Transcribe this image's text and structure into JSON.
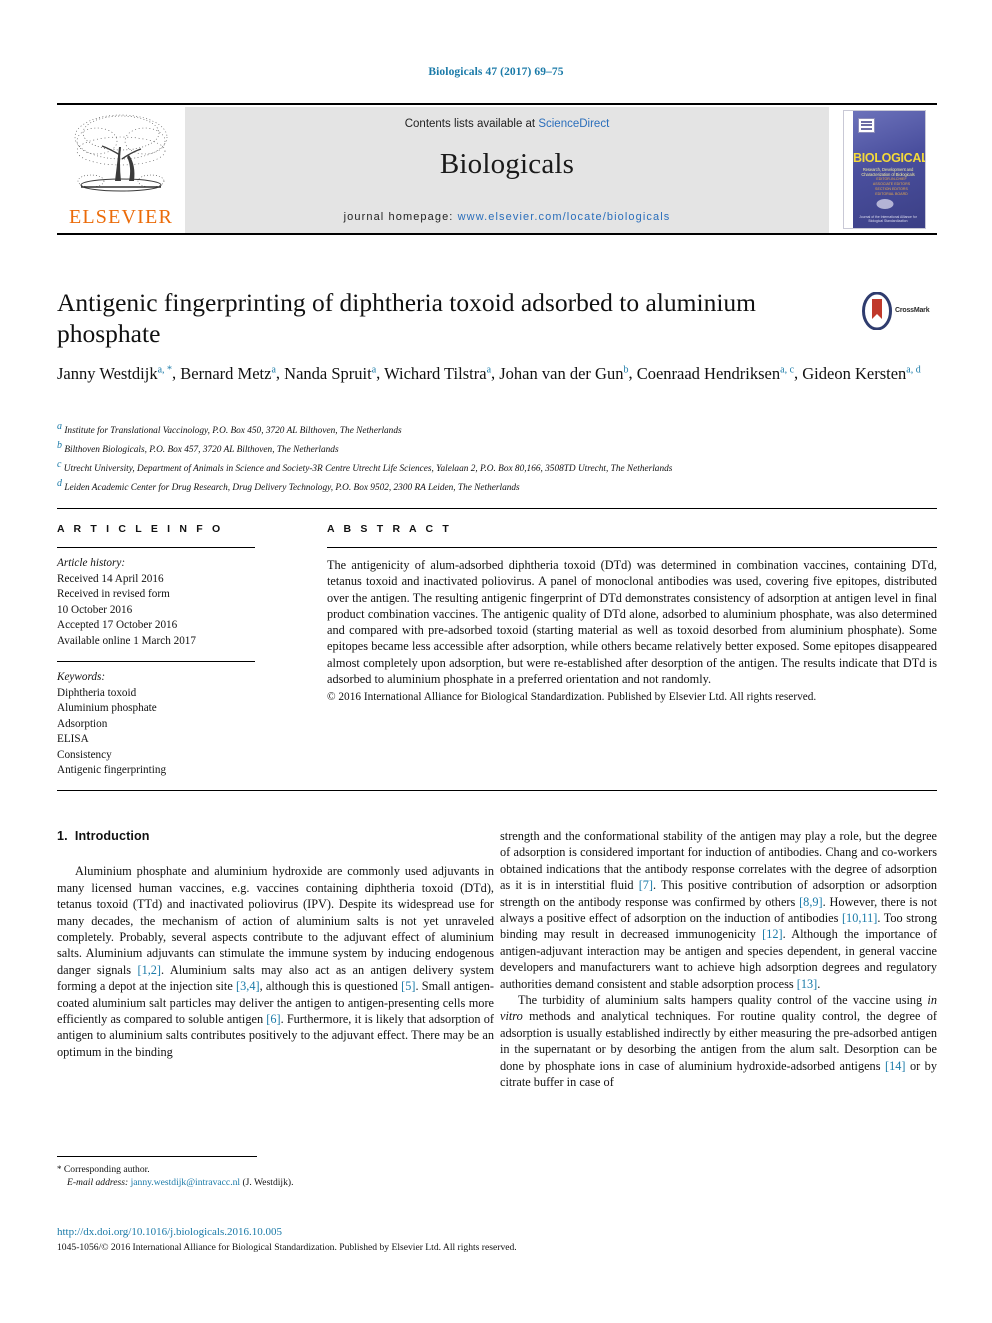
{
  "running_head": "Biologicals 47 (2017) 69–75",
  "masthead": {
    "publisher_name": "ELSEVIER",
    "contents_prefix": "Contents lists available at ",
    "contents_link": "ScienceDirect",
    "journal_name": "Biologicals",
    "homepage_prefix": "journal homepage: ",
    "homepage_url": "www.elsevier.com/locate/biologicals",
    "cover": {
      "title": "BIOLOGICALS",
      "subtitle": "Research, Development and Characterization of Biologicals",
      "lines": [
        "EDITOR-IN-CHIEF",
        "ASSOCIATE EDITORS",
        "SECTION EDITORS",
        "EDITORIAL BOARD"
      ],
      "footer": "Journal of the International Alliance for Biological Standardization"
    }
  },
  "article": {
    "title": "Antigenic fingerprinting of diphtheria toxoid adsorbed to aluminium phosphate",
    "crossmark_label": "CrossMark",
    "authors": [
      {
        "name": "Janny Westdijk",
        "marks": "a, *",
        "sep": ", "
      },
      {
        "name": "Bernard Metz",
        "marks": "a",
        "sep": ", "
      },
      {
        "name": "Nanda Spruit",
        "marks": "a",
        "sep": ", "
      },
      {
        "name": "Wichard Tilstra",
        "marks": "a",
        "sep": ", "
      },
      {
        "name": "Johan van der Gun",
        "marks": "b",
        "sep": ", "
      },
      {
        "name": "Coenraad Hendriksen",
        "marks": "a, c",
        "sep": ", "
      },
      {
        "name": "Gideon Kersten",
        "marks": "a, d",
        "sep": ""
      }
    ],
    "affiliations": [
      {
        "mark": "a",
        "text": "Institute for Translational Vaccinology, P.O. Box 450, 3720 AL Bilthoven, The Netherlands"
      },
      {
        "mark": "b",
        "text": "Bilthoven Biologicals, P.O. Box 457, 3720 AL Bilthoven, The Netherlands"
      },
      {
        "mark": "c",
        "text": "Utrecht University, Department of Animals in Science and Society-3R Centre Utrecht Life Sciences, Yalelaan 2, P.O. Box 80,166, 3508TD Utrecht, The Netherlands"
      },
      {
        "mark": "d",
        "text": "Leiden Academic Center for Drug Research, Drug Delivery Technology, P.O. Box 9502, 2300 RA Leiden, The Netherlands"
      }
    ]
  },
  "article_info": {
    "heading": "A R T I C L E    I N F O",
    "history_label": "Article history:",
    "history": [
      "Received 14 April 2016",
      "Received in revised form",
      "10 October 2016",
      "Accepted 17 October 2016",
      "Available online 1 March 2017"
    ],
    "keywords_label": "Keywords:",
    "keywords": [
      "Diphtheria toxoid",
      "Aluminium phosphate",
      "Adsorption",
      "ELISA",
      "Consistency",
      "Antigenic fingerprinting"
    ]
  },
  "abstract": {
    "heading": "A B S T R A C T",
    "text": "The antigenicity of alum-adsorbed diphtheria toxoid (DTd) was determined in combination vaccines, containing DTd, tetanus toxoid and inactivated poliovirus. A panel of monoclonal antibodies was used, covering five epitopes, distributed over the antigen. The resulting antigenic fingerprint of DTd demonstrates consistency of adsorption at antigen level in final product combination vaccines. The antigenic quality of DTd alone, adsorbed to aluminium phosphate, was also determined and compared with pre-adsorbed toxoid (starting material as well as toxoid desorbed from aluminium phosphate). Some epitopes became less accessible after adsorption, while others became relatively better exposed. Some epitopes disappeared almost completely upon adsorption, but were re-established after desorption of the antigen. The results indicate that DTd is adsorbed to aluminium phosphate in a preferred orientation and not randomly.",
    "copyright": "© 2016 International Alliance for Biological Standardization. Published by Elsevier Ltd. All rights reserved."
  },
  "introduction": {
    "section_number": "1.",
    "section_title": "Introduction",
    "left_paragraph_html": "Aluminium phosphate and aluminium hydroxide are commonly used adjuvants in many licensed human vaccines, e.g. vaccines containing diphtheria toxoid (DTd), tetanus toxoid (TTd) and inactivated poliovirus (IPV). Despite its widespread use for many decades, the mechanism of action of aluminium salts is not yet unraveled completely. Probably, several aspects contribute to the adjuvant effect of aluminium salts. Aluminium adjuvants can stimulate the immune system by inducing endogenous danger signals <span class=\"ref\">[1,2]</span>. Aluminium salts may also act as an antigen delivery system forming a depot at the injection site <span class=\"ref\">[3,4]</span>, although this is questioned <span class=\"ref\">[5]</span>. Small antigen-coated aluminium salt particles may deliver the antigen to antigen-presenting cells more efficiently as compared to soluble antigen <span class=\"ref\">[6]</span>. Furthermore, it is likely that adsorption of antigen to aluminium salts contributes positively to the adjuvant effect. There may be an optimum in the binding",
    "right_paragraph_1_html": "strength and the conformational stability of the antigen may play a role, but the degree of adsorption is considered important for induction of antibodies. Chang and co-workers obtained indications that the antibody response correlates with the degree of adsorption as it is in interstitial fluid <span class=\"ref\">[7]</span>. This positive contribution of adsorption or adsorption strength on the antibody response was confirmed by others <span class=\"ref\">[8,9]</span>. However, there is not always a positive effect of adsorption on the induction of antibodies <span class=\"ref\">[10,11]</span>. Too strong binding may result in decreased immunogenicity <span class=\"ref\">[12]</span>. Although the importance of antigen-adjuvant interaction may be antigen and species dependent, in general vaccine developers and manufacturers want to achieve high adsorption degrees and regulatory authorities demand consistent and stable adsorption process <span class=\"ref\">[13]</span>.",
    "right_paragraph_2_html": "The turbidity of aluminium salts hampers quality control of the vaccine using <i>in vitro</i> methods and analytical techniques. For routine quality control, the degree of adsorption is usually established indirectly by either measuring the pre-adsorbed antigen in the supernatant or by desorbing the antigen from the alum salt. Desorption can be done by phosphate ions in case of aluminium hydroxide-adsorbed antigens <span class=\"ref\">[14]</span> or by citrate buffer in case of"
  },
  "footer": {
    "corresponding_author": "Corresponding author.",
    "email_label": "E-mail address:",
    "email": "janny.westdijk@intravacc.nl",
    "email_owner": "(J. Westdijk).",
    "doi": "http://dx.doi.org/10.1016/j.biologicals.2016.10.005",
    "issn_line": "1045-1056/© 2016 International Alliance for Biological Standardization. Published by Elsevier Ltd. All rights reserved."
  },
  "colors": {
    "link": "#1a7aa8",
    "elsevier_orange": "#eb6b09",
    "sciencedirect_blue": "#2a6ebb"
  }
}
